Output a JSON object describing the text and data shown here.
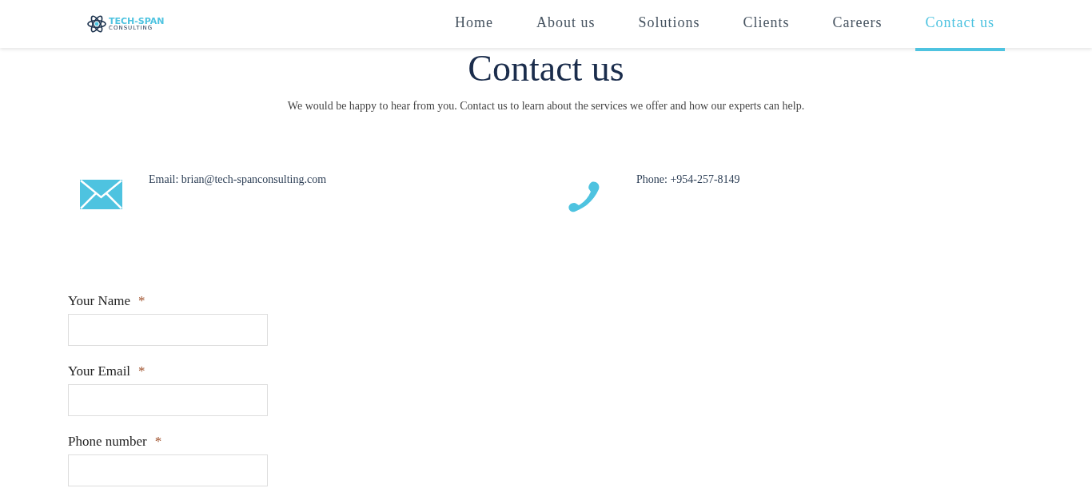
{
  "logo": {
    "name": "TECH-SPAN",
    "tagline": "CONSULTING"
  },
  "nav": [
    {
      "label": "Home",
      "selected": false
    },
    {
      "label": "About us",
      "selected": false
    },
    {
      "label": "Solutions",
      "selected": false
    },
    {
      "label": "Clients",
      "selected": false
    },
    {
      "label": "Careers",
      "selected": false
    },
    {
      "label": "Contact us",
      "selected": true
    }
  ],
  "heading": "Contact us",
  "intro": "We would be happy to hear from you. Contact us to learn about the services we offer and how our experts can help.",
  "contacts": [
    {
      "kind": "email",
      "text": "Email: brian@tech-spanconsulting.com"
    },
    {
      "kind": "phone",
      "text": "Phone: +954-257-8149"
    }
  ],
  "form": [
    {
      "label": "Your Name",
      "required_mark": "*"
    },
    {
      "label": "Your Email",
      "required_mark": "*"
    },
    {
      "label": "Phone number",
      "required_mark": "*"
    }
  ]
}
